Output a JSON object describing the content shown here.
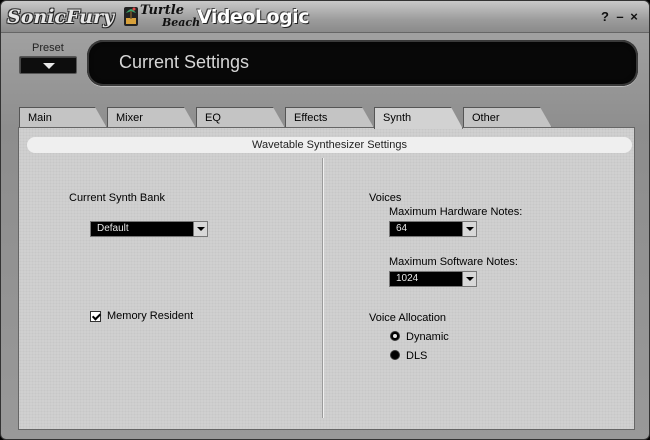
{
  "titlebar": {
    "brand_sonic": "SonicFury",
    "brand_turtle": "Turtle",
    "brand_beach": "Beach",
    "brand_video": "VideoLogic",
    "help_label": "?",
    "minimize_label": "–",
    "close_label": "×"
  },
  "header": {
    "preset_label": "Preset",
    "display_text": "Current Settings"
  },
  "tabs": [
    {
      "label": "Main"
    },
    {
      "label": "Mixer"
    },
    {
      "label": "EQ"
    },
    {
      "label": "Effects"
    },
    {
      "label": "Synth",
      "active": true
    },
    {
      "label": "Other"
    }
  ],
  "panel": {
    "section_title": "Wavetable Synthesizer Settings",
    "left": {
      "bank_label": "Current Synth Bank",
      "bank_value": "Default",
      "memory_resident_label": "Memory Resident",
      "memory_resident_checked": true
    },
    "right": {
      "voices_label": "Voices",
      "hw_notes_label": "Maximum Hardware Notes:",
      "hw_notes_value": "64",
      "sw_notes_label": "Maximum Software Notes:",
      "sw_notes_value": "1024",
      "allocation_label": "Voice Allocation",
      "options": [
        {
          "label": "Dynamic",
          "selected": true
        },
        {
          "label": "DLS",
          "selected": false
        }
      ]
    }
  },
  "icons": {
    "preset": "chevron-down-icon",
    "dropdown": "chevron-down-icon",
    "logo": "palm-tree-icon"
  },
  "colors": {
    "lcd_background": "#080808",
    "lcd_text": "#d6d6d6",
    "panel_background": "#d0d0d0"
  }
}
